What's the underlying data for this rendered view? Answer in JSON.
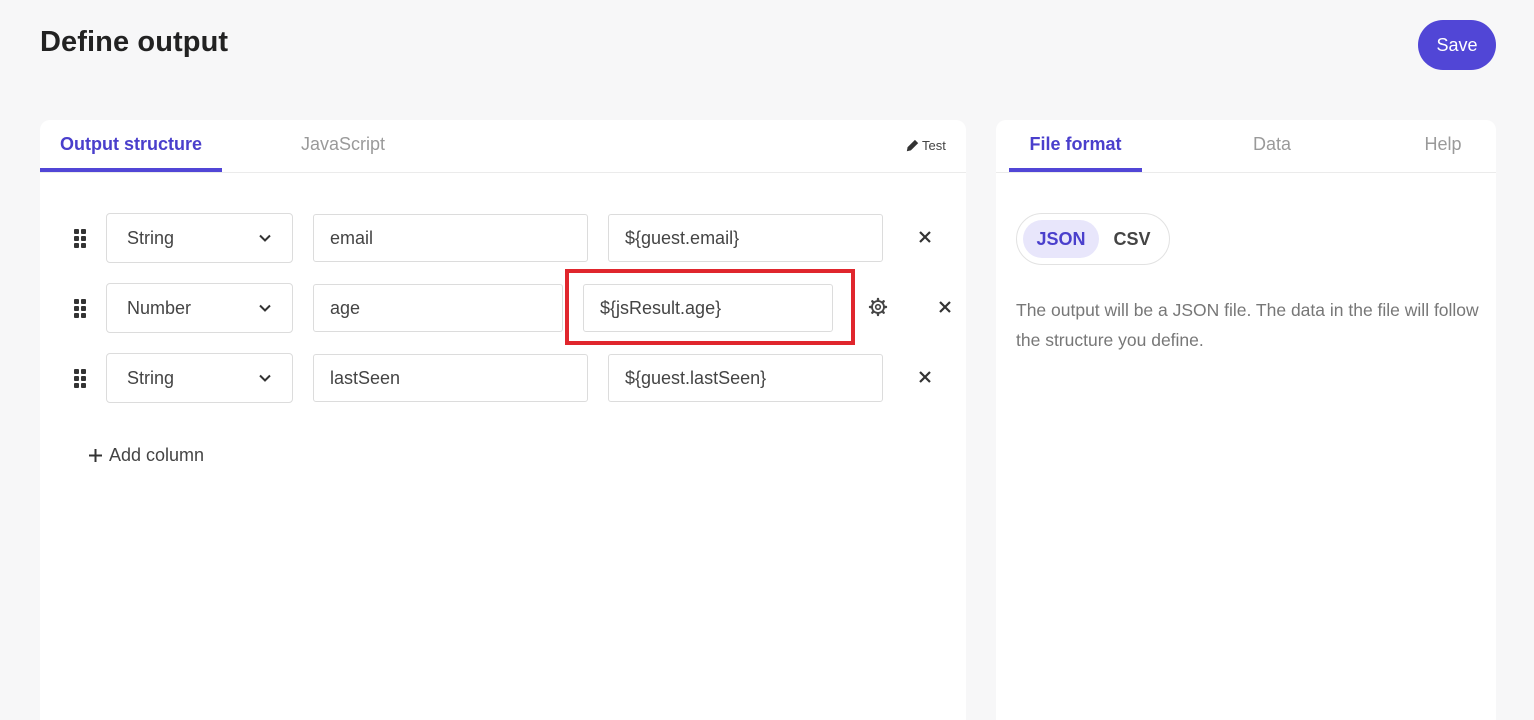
{
  "header": {
    "title": "Define output",
    "save_label": "Save"
  },
  "left_panel": {
    "tabs": [
      {
        "label": "Output structure",
        "active": true
      },
      {
        "label": "JavaScript",
        "active": false
      }
    ],
    "test_label": "Test",
    "rows": [
      {
        "type": "String",
        "name": "email",
        "value": "${guest.email}",
        "has_settings": false
      },
      {
        "type": "Number",
        "name": "age",
        "value": "${jsResult.age}",
        "has_settings": true,
        "highlighted": true
      },
      {
        "type": "String",
        "name": "lastSeen",
        "value": "${guest.lastSeen}",
        "has_settings": false
      }
    ],
    "add_column_label": "Add column"
  },
  "right_panel": {
    "tabs": [
      {
        "label": "File format",
        "active": true
      },
      {
        "label": "Data",
        "active": false
      },
      {
        "label": "Help",
        "active": false
      }
    ],
    "format_options": [
      {
        "label": "JSON",
        "selected": true
      },
      {
        "label": "CSV",
        "selected": false
      }
    ],
    "description": "The output will be a JSON file. The data in the file will follow the structure you define."
  },
  "colors": {
    "accent": "#5146d6",
    "highlight": "#e0262d"
  },
  "icons": [
    "drag-handle-icon",
    "chevron-down-icon",
    "close-icon",
    "gear-icon",
    "pen-icon",
    "plus-icon"
  ]
}
